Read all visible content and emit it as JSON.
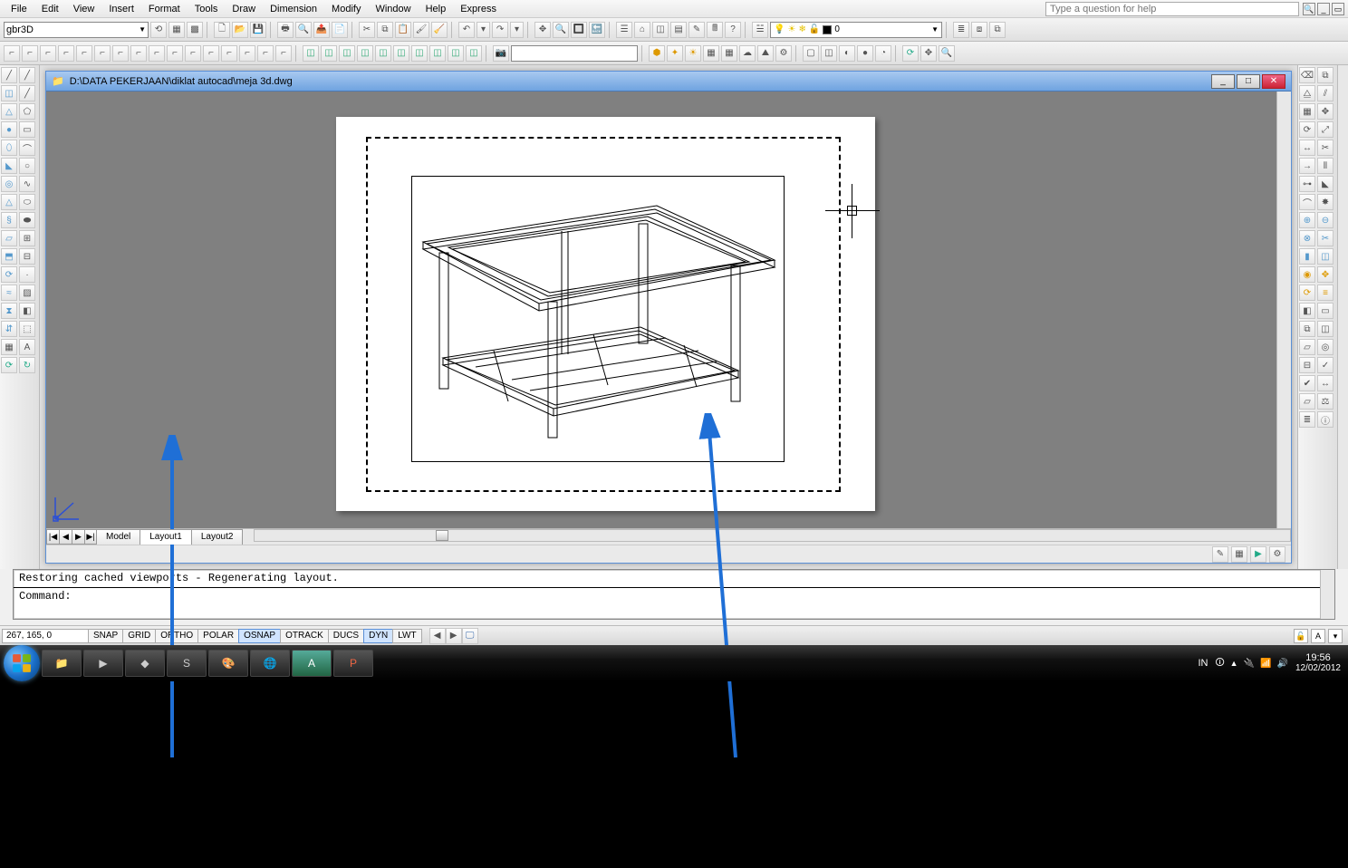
{
  "menu": [
    "File",
    "Edit",
    "View",
    "Insert",
    "Format",
    "Tools",
    "Draw",
    "Dimension",
    "Modify",
    "Window",
    "Help",
    "Express"
  ],
  "help_placeholder": "Type a question for help",
  "layer_combo_value": "gbr3D",
  "layer_state_value": "0",
  "doc_title": "D:\\DATA PEKERJAAN\\diklat autocad\\meja 3d.dwg",
  "tabs": {
    "nav": [
      "|◀",
      "◀",
      "▶",
      "▶|"
    ],
    "items": [
      "Model",
      "Layout1",
      "Layout2"
    ],
    "active": 1
  },
  "cmd_history": "Restoring cached viewports - Regenerating layout.",
  "cmd_prompt": "Command:",
  "coords": "267, 165, 0",
  "toggles": [
    "SNAP",
    "GRID",
    "ORTHO",
    "POLAR",
    "OSNAP",
    "OTRACK",
    "DUCS",
    "DYN",
    "LWT"
  ],
  "toggles_active": [
    "OSNAP",
    "DYN"
  ],
  "systray": {
    "lang": "IN",
    "time": "19:56",
    "date": "12/02/2012"
  },
  "colors": {
    "title_grad_a": "#a8c9f0",
    "title_grad_b": "#6fa3e0",
    "arrow": "#1f6fd6"
  }
}
